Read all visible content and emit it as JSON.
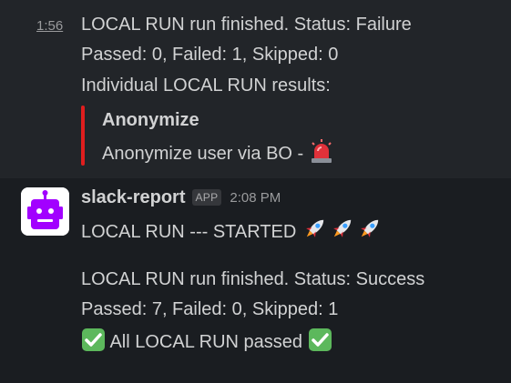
{
  "message_1": {
    "time": "1:56",
    "line1": "LOCAL RUN run finished. Status: Failure",
    "line2": "Passed: 0, Failed: 1, Skipped: 0",
    "line3": "Individual LOCAL RUN results:",
    "attachment": {
      "title": "Anonymize",
      "text": "Anonymize user via BO - ",
      "bar_color": "#e01e1e",
      "icon": "siren-icon"
    }
  },
  "message_2": {
    "sender": "slack-report",
    "badge": "APP",
    "time": "2:08 PM",
    "avatar_icon": "robot-icon",
    "avatar_color": "#a200ff",
    "line1": "LOCAL RUN --- STARTED ",
    "rocket_icons": [
      "rocket-icon",
      "rocket-icon",
      "rocket-icon"
    ]
  },
  "message_3": {
    "line1": "LOCAL RUN run finished. Status: Success",
    "line2": "Passed: 7, Failed: 0, Skipped: 1",
    "line3_text": " All LOCAL RUN passed ",
    "check_icon": "check-mark-button-icon",
    "check_color": "#5cb85c"
  }
}
